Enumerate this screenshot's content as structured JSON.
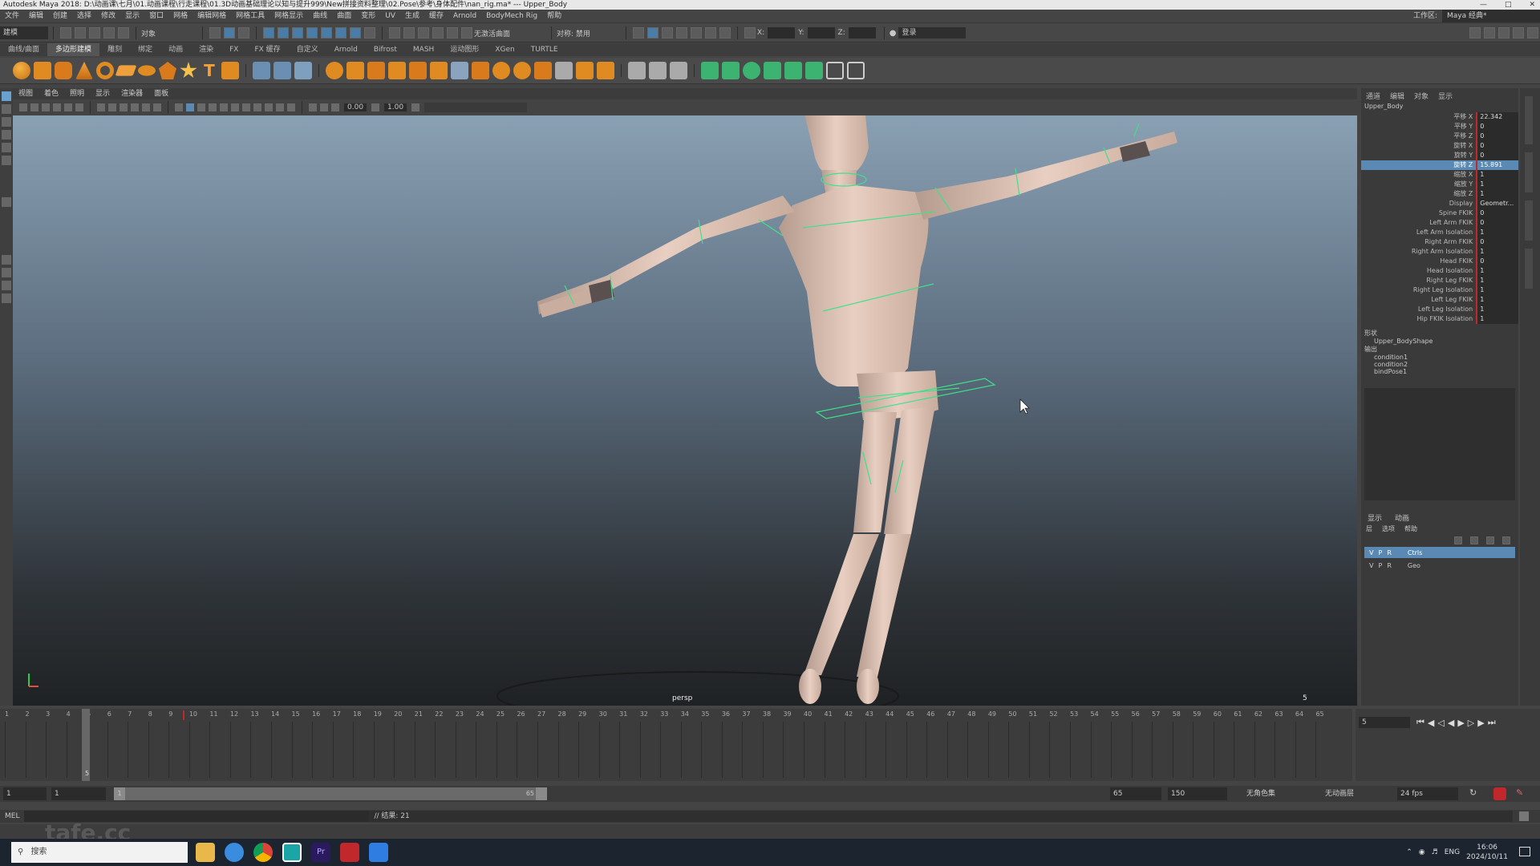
{
  "window": {
    "title": "Autodesk Maya 2018: D:\\动画课\\七月\\01.动画课程\\行走课程\\01.3D动画基础理论以知与提升999\\New拼接资料整理\\02.Pose\\参考\\身体配件\\nan_rig.ma* --- Upper_Body",
    "controls": [
      "—",
      "□",
      "✕"
    ]
  },
  "menus": [
    "文件",
    "编辑",
    "创建",
    "选择",
    "修改",
    "显示",
    "窗口",
    "网格",
    "编辑网格",
    "网格工具",
    "网格显示",
    "曲线",
    "曲面",
    "变形",
    "UV",
    "生成",
    "缓存",
    "Arnold",
    "BodyMech Rig",
    "帮助"
  ],
  "workspace": {
    "label": "工作区:",
    "value": "Maya 经典*"
  },
  "status_line": {
    "mode": "建模",
    "object_label": "对象",
    "live_surface": "无激活曲面",
    "symmetry": "对称: 禁用",
    "field_x": "X:",
    "field_y": "Y:",
    "field_z": "Z:",
    "login": "登录"
  },
  "shelf_tabs": [
    "曲线/曲面",
    "多边形建模",
    "雕刻",
    "绑定",
    "动画",
    "渲染",
    "FX",
    "FX 缓存",
    "自定义",
    "Arnold",
    "Bifrost",
    "MASH",
    "运动图形",
    "XGen",
    "TURTLE"
  ],
  "shelf_active_tab": "多边形建模",
  "viewport": {
    "menu": [
      "视图",
      "着色",
      "照明",
      "显示",
      "渲染器",
      "面板"
    ],
    "near_value": "0.00",
    "far_value": "1.00",
    "camera": "persp",
    "frame_marker": "5"
  },
  "channel_box": {
    "tabs": [
      "通道",
      "编辑",
      "对象",
      "显示"
    ],
    "object_name": "Upper_Body",
    "attributes": [
      {
        "name": "平移 X",
        "value": "22.342"
      },
      {
        "name": "平移 Y",
        "value": "0"
      },
      {
        "name": "平移 Z",
        "value": "0"
      },
      {
        "name": "旋转 X",
        "value": "0"
      },
      {
        "name": "旋转 Y",
        "value": "0"
      },
      {
        "name": "旋转 Z",
        "value": "15.891",
        "selected": true
      },
      {
        "name": "缩放 X",
        "value": "1"
      },
      {
        "name": "缩放 Y",
        "value": "1"
      },
      {
        "name": "缩放 Z",
        "value": "1"
      },
      {
        "name": "Display",
        "value": "Geometr..."
      },
      {
        "name": "Spine FKIK",
        "value": "0"
      },
      {
        "name": "Left Arm FKIK",
        "value": "0"
      },
      {
        "name": "Left Arm Isolation",
        "value": "1"
      },
      {
        "name": "Right Arm FKIK",
        "value": "0"
      },
      {
        "name": "Right Arm Isolation",
        "value": "1"
      },
      {
        "name": "Head FKIK",
        "value": "0"
      },
      {
        "name": "Head Isolation",
        "value": "1"
      },
      {
        "name": "Right Leg FKIK",
        "value": "1"
      },
      {
        "name": "Right Leg Isolation",
        "value": "1"
      },
      {
        "name": "Left Leg FKIK",
        "value": "1"
      },
      {
        "name": "Left Leg Isolation",
        "value": "1"
      },
      {
        "name": "Hip FKIK Isolation",
        "value": "1"
      }
    ],
    "shapes_header": "形状",
    "shapes": [
      "Upper_BodyShape"
    ],
    "outputs_header": "输出",
    "outputs": [
      "condition1",
      "condition2",
      "bindPose1"
    ]
  },
  "layer_editor": {
    "tabs": [
      "显示",
      "动画"
    ],
    "menu": [
      "层",
      "选项",
      "帮助"
    ],
    "layers": [
      {
        "v": "V",
        "p": "P",
        "r": "R",
        "name": "Ctrls",
        "selected": true
      },
      {
        "v": "V",
        "p": "P",
        "r": "R",
        "name": "Geo",
        "selected": false
      }
    ]
  },
  "timeline": {
    "ticks": [
      "1",
      "2",
      "3",
      "4",
      "5",
      "6",
      "7",
      "8",
      "9",
      "10",
      "11",
      "12",
      "13",
      "14",
      "15",
      "16",
      "17",
      "18",
      "19",
      "20",
      "21",
      "22",
      "23",
      "24",
      "25",
      "26",
      "27",
      "28",
      "29",
      "30",
      "31",
      "32",
      "33",
      "34",
      "35",
      "36",
      "37",
      "38",
      "39",
      "40",
      "41",
      "42",
      "43",
      "44",
      "45",
      "46",
      "47",
      "48",
      "49",
      "50",
      "51",
      "52",
      "53",
      "54",
      "55",
      "56",
      "57",
      "58",
      "59",
      "60",
      "61",
      "62",
      "63",
      "64",
      "65"
    ],
    "current_frame": "5",
    "current_frame_field": "5"
  },
  "range_slider": {
    "start": "1",
    "inner_start": "1",
    "handle_start": "1",
    "handle_end": "65",
    "end": "65",
    "max": "150",
    "char_set": "无角色集",
    "anim_layer": "无动画层",
    "fps": "24 fps"
  },
  "command_line": {
    "label": "MEL",
    "result": "// 结果: 21"
  },
  "taskbar": {
    "search_placeholder": "搜索",
    "time": "16:06",
    "date": "2024/10/11",
    "lang": "ENG"
  },
  "watermark": "tafe.cc",
  "colors": {
    "panel": "#444444",
    "selection": "#5a8ab4",
    "keyed": "#c0282c",
    "rig_ctrl": "#3fe08a",
    "skin": "#e4c7b8"
  }
}
